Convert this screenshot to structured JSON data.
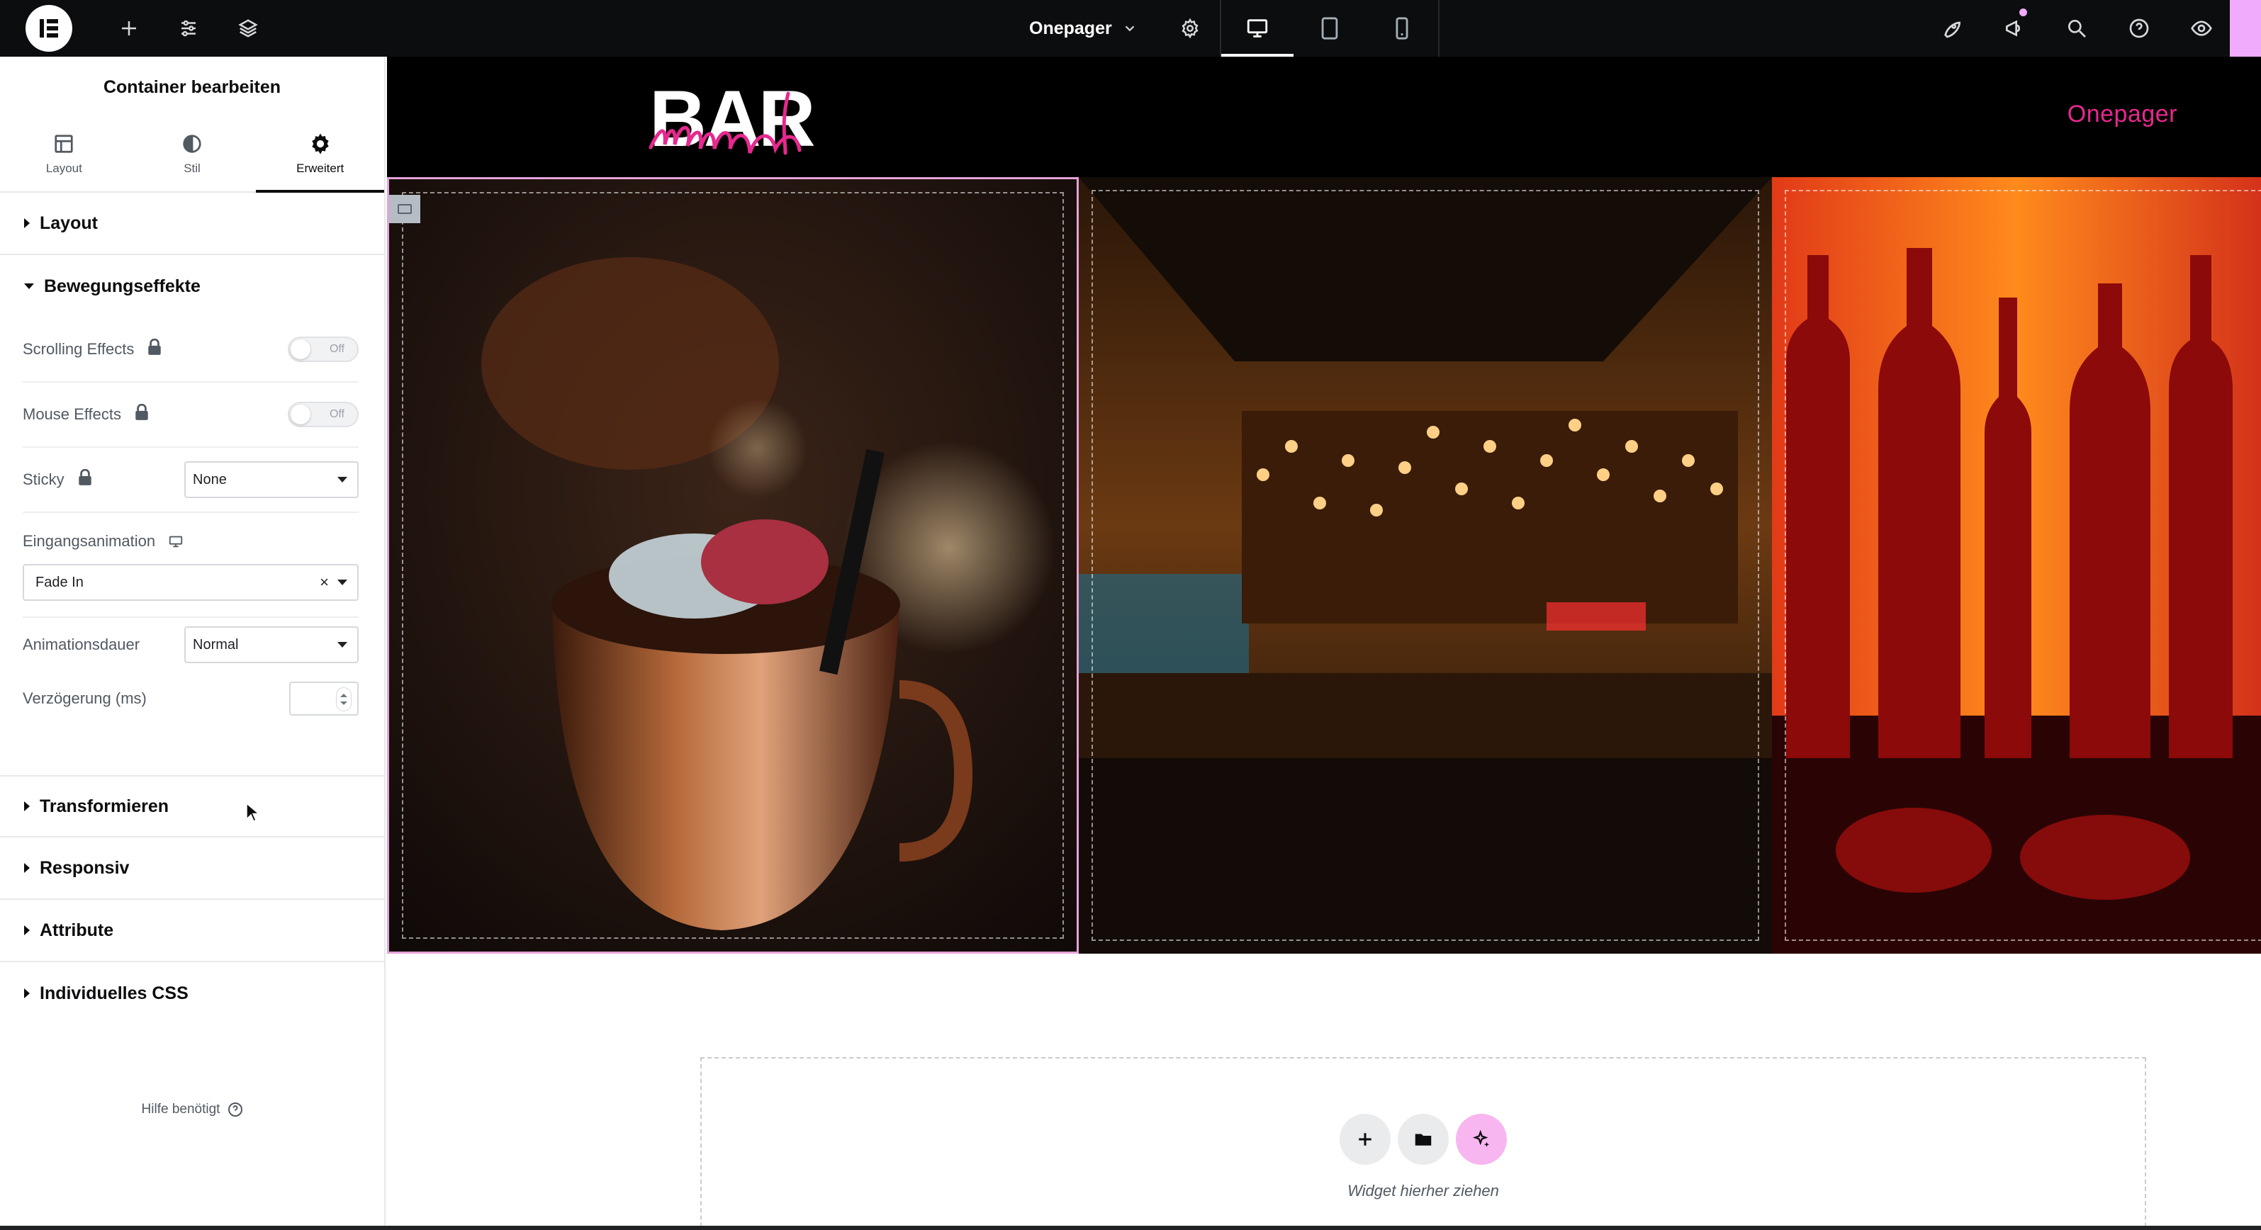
{
  "topbar": {
    "page_name": "Onepager"
  },
  "panel": {
    "title": "Container bearbeiten",
    "tabs": [
      {
        "label": "Layout"
      },
      {
        "label": "Stil"
      },
      {
        "label": "Erweitert"
      }
    ],
    "sections": {
      "layout": "Layout",
      "motion": "Bewegungseffekte",
      "transform": "Transformieren",
      "responsive": "Responsiv",
      "attributes": "Attribute",
      "custom_css": "Individuelles CSS"
    },
    "motion": {
      "scrolling_label": "Scrolling Effects",
      "scrolling_value": "Off",
      "mouse_label": "Mouse Effects",
      "mouse_value": "Off",
      "sticky_label": "Sticky",
      "sticky_value": "None",
      "entrance_label": "Eingangsanimation",
      "entrance_value": "Fade In",
      "entrance_clear": "×",
      "duration_label": "Animationsdauer",
      "duration_value": "Normal",
      "delay_label": "Verzögerung (ms)",
      "delay_value": ""
    },
    "help": "Hilfe benötigt"
  },
  "site": {
    "nav_item": "Onepager",
    "brand": "BAR wunder"
  },
  "dropzone": {
    "text": "Widget hierher ziehen"
  },
  "colors": {
    "accent_pink": "#e6288e",
    "ai_pink": "#f7b6f0",
    "topbar_bg": "#0c0d0e"
  }
}
